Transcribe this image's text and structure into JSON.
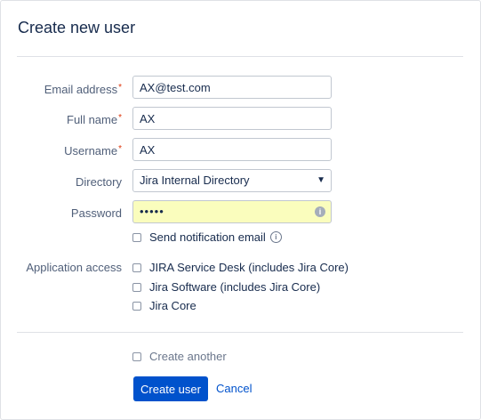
{
  "dialog": {
    "title": "Create new user"
  },
  "form": {
    "email": {
      "label": "Email address",
      "required_mark": "*",
      "value": "AX@test.com"
    },
    "fullname": {
      "label": "Full name",
      "required_mark": "*",
      "value": "AX"
    },
    "username": {
      "label": "Username",
      "required_mark": "*",
      "value": "AX"
    },
    "directory": {
      "label": "Directory",
      "selected": "Jira Internal Directory",
      "arrow": "▼"
    },
    "password": {
      "label": "Password",
      "masked_value": "•••••",
      "badge": "i"
    },
    "send_notification": {
      "label": "Send notification email",
      "info": "i",
      "checked": false
    },
    "application_access": {
      "label": "Application access",
      "options": [
        {
          "label": "JIRA Service Desk (includes Jira Core)",
          "checked": false
        },
        {
          "label": "Jira Software (includes Jira Core)",
          "checked": false
        },
        {
          "label": "Jira Core",
          "checked": false
        }
      ]
    },
    "create_another": {
      "label": "Create another",
      "checked": false
    }
  },
  "actions": {
    "create_label": "Create user",
    "cancel_label": "Cancel"
  },
  "colors": {
    "primary": "#0052cc",
    "required": "#de350b",
    "autofill": "#fafdbd"
  }
}
